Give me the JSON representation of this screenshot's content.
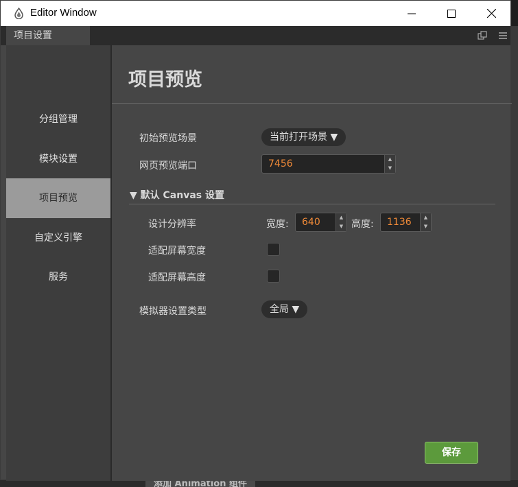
{
  "window": {
    "title": "Editor Window",
    "tab_label": "项目设置"
  },
  "background": {
    "bottom_label": "添加 Animation 组件"
  },
  "sidebar": {
    "items": [
      {
        "label": "分组管理"
      },
      {
        "label": "模块设置"
      },
      {
        "label": "项目预览",
        "active": true
      },
      {
        "label": "自定义引擎"
      },
      {
        "label": "服务"
      }
    ]
  },
  "main": {
    "title": "项目预览",
    "initial_scene_label": "初始预览场景",
    "initial_scene_value": "当前打开场景 ▼",
    "port_label": "网页预览端口",
    "port_value": "7456",
    "canvas_section_title": "▼ 默认 Canvas 设置",
    "resolution_label": "设计分辨率",
    "width_label": "宽度:",
    "width_value": "640",
    "height_label": "高度:",
    "height_value": "1136",
    "fit_width_label": "适配屏幕宽度",
    "fit_height_label": "适配屏幕高度",
    "simulator_label": "模拟器设置类型",
    "simulator_value": "全局 ▼",
    "save_label": "保存"
  },
  "colors": {
    "accent_orange": "#f08a38",
    "save_green": "#5c9a3c",
    "active_sidebar": "#9b9b9b"
  }
}
